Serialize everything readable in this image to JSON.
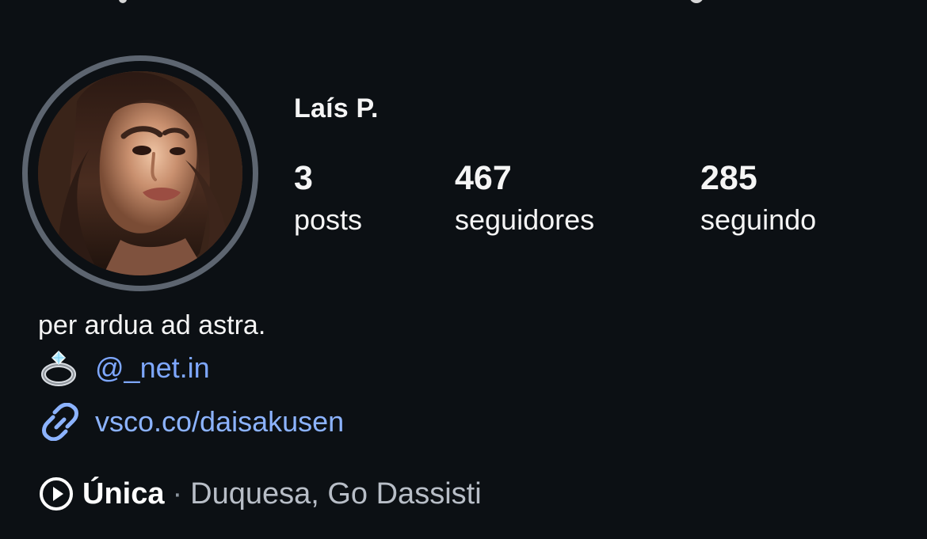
{
  "profile": {
    "name": "Laís P.",
    "stats": [
      {
        "value": "3",
        "label": "posts"
      },
      {
        "value": "467",
        "label": "seguidores"
      },
      {
        "value": "285",
        "label": "seguindo"
      }
    ],
    "bio": "per ardua ad astra.",
    "mention": "@_net.in",
    "link": "vsco.co/daisakusen",
    "music": {
      "title": "Única",
      "separator": "·",
      "artist": "Duquesa, Go Dassisti"
    }
  },
  "icons": {
    "ring": "ring-icon",
    "link": "link-icon",
    "play": "play-icon"
  },
  "colors": {
    "background": "#0c1014",
    "link": "#8cb3ff",
    "ring": "#5d6570"
  }
}
